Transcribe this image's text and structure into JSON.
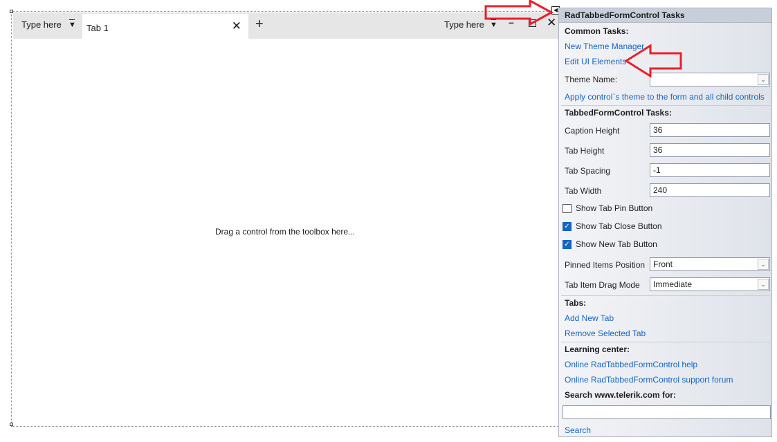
{
  "form": {
    "left_type_here": "Type here",
    "tab_label": "Tab 1",
    "new_tab_symbol": "+",
    "right_type_here": "Type here",
    "drag_hint": "Drag a control from the toolbox here..."
  },
  "task_panel": {
    "title": "RadTabbedFormControl Tasks",
    "common_tasks_title": "Common Tasks:",
    "new_theme_manager": "New Theme Manager",
    "edit_ui_elements": "Edit UI Elements",
    "theme_name_label": "Theme Name:",
    "theme_name_value": "",
    "apply_theme_link": "Apply control`s theme to the form and all child controls",
    "tabbed_tasks_title": "TabbedFormControl Tasks:",
    "caption_height_label": "Caption Height",
    "caption_height_value": "36",
    "tab_height_label": "Tab Height",
    "tab_height_value": "36",
    "tab_spacing_label": "Tab Spacing",
    "tab_spacing_value": "-1",
    "tab_width_label": "Tab Width",
    "tab_width_value": "240",
    "show_tab_pin_label": "Show Tab Pin Button",
    "show_tab_pin_checked": false,
    "show_tab_close_label": "Show Tab Close Button",
    "show_tab_close_checked": true,
    "show_new_tab_label": "Show New Tab Button",
    "show_new_tab_checked": true,
    "pinned_position_label": "Pinned Items Position",
    "pinned_position_value": "Front",
    "drag_mode_label": "Tab Item Drag Mode",
    "drag_mode_value": "Immediate",
    "tabs_title": "Tabs:",
    "add_new_tab": "Add New Tab",
    "remove_selected_tab": "Remove Selected Tab",
    "learning_title": "Learning center:",
    "online_help": "Online RadTabbedFormControl help",
    "support_forum": "Online RadTabbedFormControl support forum",
    "search_title": "Search www.telerik.com for:",
    "search_value": "",
    "search_link": "Search"
  },
  "colors": {
    "link": "#1764c2",
    "annotation_arrow": "#e8202a",
    "panel_header": "#c8cfda"
  }
}
